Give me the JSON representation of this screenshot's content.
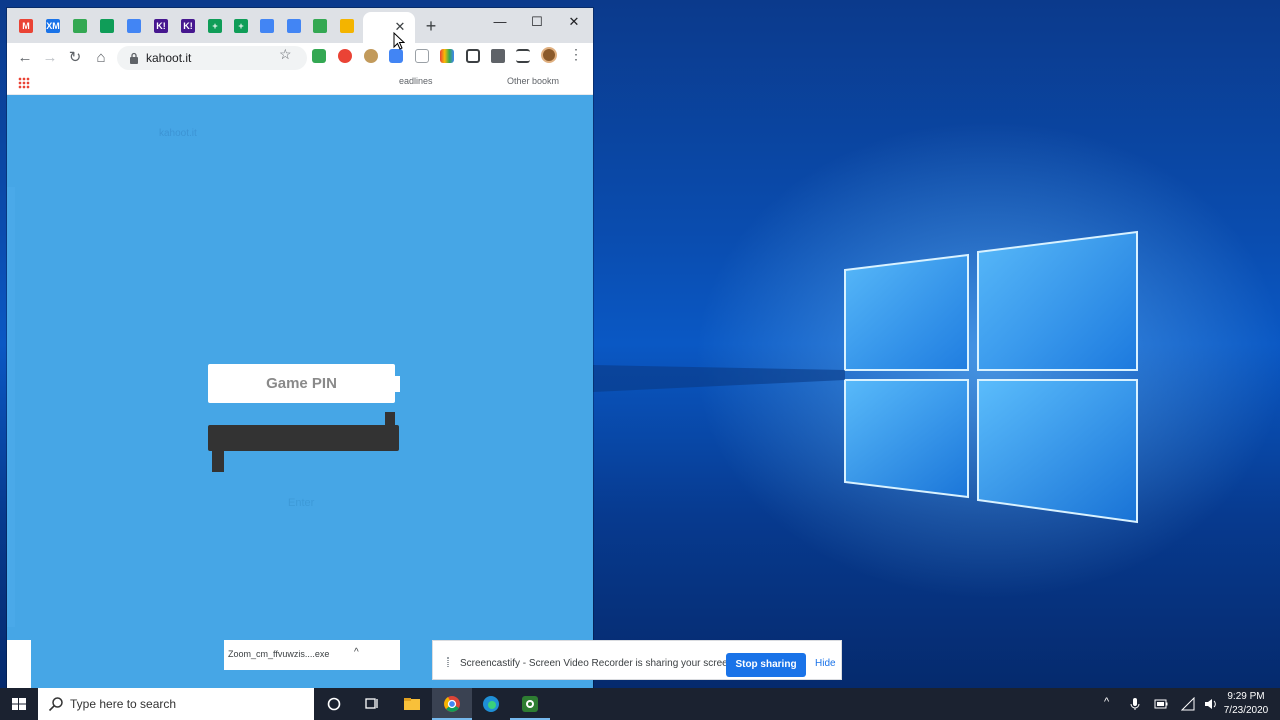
{
  "browser": {
    "tabs": [
      {
        "icon": "gmail-icon",
        "glyph": "M",
        "color": "#ea4335"
      },
      {
        "icon": "xm-icon",
        "glyph": "XM",
        "color": "#1a73e8"
      },
      {
        "icon": "google-drive-icon",
        "glyph": "",
        "color": "#34a853"
      },
      {
        "icon": "google-classroom-icon",
        "glyph": "",
        "color": "#0f9d58"
      },
      {
        "icon": "google-docs-icon",
        "glyph": "",
        "color": "#4285f4"
      },
      {
        "icon": "kahoot-icon",
        "glyph": "K!",
        "color": "#46178f"
      },
      {
        "icon": "kahoot-icon",
        "glyph": "K!",
        "color": "#46178f"
      },
      {
        "icon": "google-sheets-icon",
        "glyph": "+",
        "color": "#0f9d58"
      },
      {
        "icon": "google-sheets-icon",
        "glyph": "+",
        "color": "#0f9d58"
      },
      {
        "icon": "google-docs-icon",
        "glyph": "",
        "color": "#4285f4"
      },
      {
        "icon": "google-docs-icon",
        "glyph": "",
        "color": "#4285f4"
      },
      {
        "icon": "meet-icon",
        "glyph": "",
        "color": "#34a853"
      },
      {
        "icon": "slides-icon",
        "glyph": "",
        "color": "#f4b400"
      },
      {
        "icon": "screencastify-icon",
        "glyph": "",
        "color": "#2e7d6b"
      }
    ],
    "tab_close": "✕",
    "new_tab": "+",
    "window_controls": {
      "minimize": "—",
      "maximize": "☐",
      "close": "✕"
    },
    "nav": {
      "back": "←",
      "forward": "→",
      "reload": "↻",
      "home": "⌂"
    },
    "url": "kahoot.it",
    "star": "☆",
    "menu": "⋮",
    "bookmarks": {
      "left": "eadlines",
      "right": "Other bookm"
    }
  },
  "page": {
    "ghost_row1": [
      "kahoot.it"
    ],
    "pin_placeholder": "Game PIN",
    "enter_faint": "Enter"
  },
  "download": {
    "filename": "Zoom_cm_ffvuwzis....exe",
    "caret": "^"
  },
  "share_banner": {
    "message": "Screencastify - Screen Video Recorder is sharing your screen.",
    "stop_label": "Stop sharing",
    "hide_label": "Hide"
  },
  "taskbar": {
    "search_placeholder": "Type here to search",
    "time": "9:29 PM",
    "date": "7/23/2020",
    "tray_up": "^"
  }
}
